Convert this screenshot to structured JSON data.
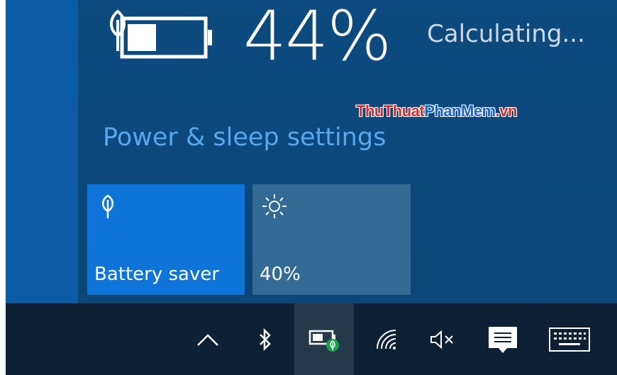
{
  "battery": {
    "percent": "44%",
    "status": "Calculating...",
    "charge_level": 0.44
  },
  "watermark": {
    "part1": "ThuThuat",
    "part2": "PhanMem",
    "part3": ".vn"
  },
  "settings_link": "Power & sleep settings",
  "tiles": [
    {
      "label": "Battery saver",
      "icon": "leaf-icon",
      "active": true,
      "color": "#0f74d9"
    },
    {
      "label": "40%",
      "icon": "brightness-icon",
      "active": false,
      "color": "#336b97"
    }
  ],
  "taskbar": {
    "icons": [
      "chevron-up-icon",
      "bluetooth-icon",
      "battery-saver-tray-icon",
      "wifi-icon",
      "volume-muted-icon",
      "action-center-icon",
      "touch-keyboard-icon"
    ]
  },
  "colors": {
    "accent": "#0f74d9",
    "flyout_bg": "#0b4678",
    "link": "#58a7ec",
    "taskbar_bg": "#0c2036"
  }
}
